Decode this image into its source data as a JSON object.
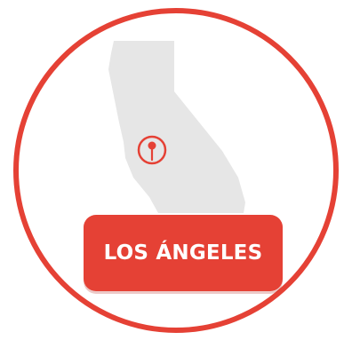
{
  "badge": {
    "label": "LOS ÁNGELES",
    "accent_color": "#e54135",
    "map_color": "#e6e6e6"
  },
  "icons": {
    "map": "california-state-map",
    "pin": "map-pin-icon"
  }
}
